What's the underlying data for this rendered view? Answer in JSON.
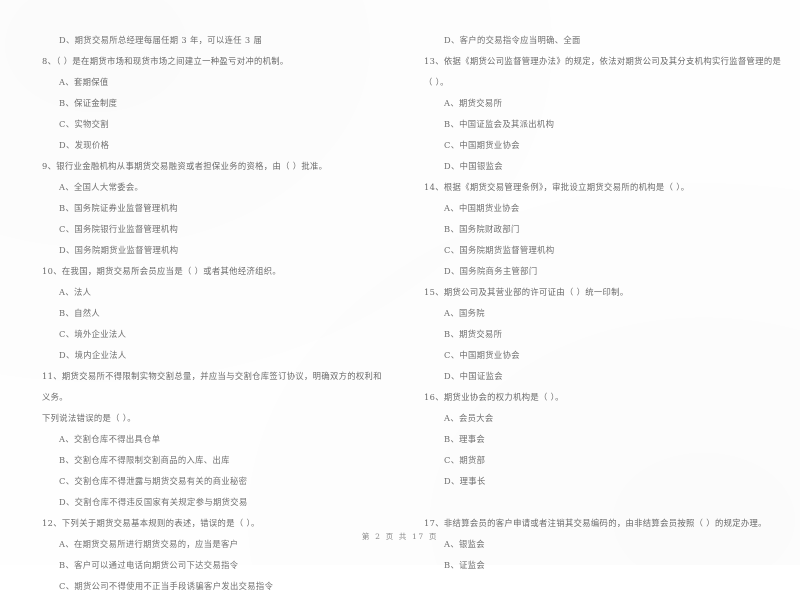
{
  "document": {
    "type": "exam-paper",
    "language": "zh-CN",
    "footer": "第 2 页 共 17 页"
  },
  "left_column": {
    "blocks": [
      {
        "kind": "option",
        "text": "D、期货交易所总经理每届任期 3 年，可以连任 3 届"
      },
      {
        "kind": "stem",
        "text": "8、（      ）是在期货市场和现货市场之间建立一种盈亏对冲的机制。"
      },
      {
        "kind": "option",
        "text": "A、套期保值"
      },
      {
        "kind": "option",
        "text": "B、保证金制度"
      },
      {
        "kind": "option",
        "text": "C、实物交割"
      },
      {
        "kind": "option",
        "text": "D、发现价格"
      },
      {
        "kind": "stem",
        "text": "9、银行业金融机构从事期货交易融资或者担保业务的资格，由（      ）批准。"
      },
      {
        "kind": "option",
        "text": "A、全国人大常委会。"
      },
      {
        "kind": "option",
        "text": "B、国务院证券业监督管理机构"
      },
      {
        "kind": "option",
        "text": "C、国务院银行业监督管理机构"
      },
      {
        "kind": "option",
        "text": "D、国务院期货业监督管理机构"
      },
      {
        "kind": "stem",
        "text": "10、在我国，期货交易所会员应当是（      ）或者其他经济组织。"
      },
      {
        "kind": "option",
        "text": "A、法人"
      },
      {
        "kind": "option",
        "text": "B、自然人"
      },
      {
        "kind": "option",
        "text": "C、境外企业法人"
      },
      {
        "kind": "option",
        "text": "D、境内企业法人"
      },
      {
        "kind": "stem",
        "text": "11、期货交易所不得限制实物交割总量，并应当与交割仓库签订协议，明确双方的权利和义务。"
      },
      {
        "kind": "stem",
        "text": "下列说法错误的是（      ）。"
      },
      {
        "kind": "option",
        "text": "A、交割仓库不得出具仓单"
      },
      {
        "kind": "option",
        "text": "B、交割仓库不得限制交割商品的入库、出库"
      },
      {
        "kind": "option",
        "text": "C、交割仓库不得泄露与期货交易有关的商业秘密"
      },
      {
        "kind": "option",
        "text": "D、交割仓库不得违反国家有关规定参与期货交易"
      },
      {
        "kind": "stem",
        "text": "12、下列关于期货交易基本规则的表述，错误的是（      ）。"
      },
      {
        "kind": "option",
        "text": "A、在期货交易所进行期货交易的，应当是客户"
      },
      {
        "kind": "option",
        "text": "B、客户可以通过电话向期货公司下达交易指令"
      },
      {
        "kind": "option",
        "text": "C、期货公司不得使用不正当手段诱骗客户发出交易指令"
      }
    ]
  },
  "right_column": {
    "blocks": [
      {
        "kind": "option",
        "text": "D、客户的交易指令应当明确、全面"
      },
      {
        "kind": "stem",
        "text": "13、依据《期货公司监督管理办法》的规定，依法对期货公司及其分支机构实行监督管理的是"
      },
      {
        "kind": "stem",
        "text": "（      ）。"
      },
      {
        "kind": "option",
        "text": "A、期货交易所"
      },
      {
        "kind": "option",
        "text": "B、中国证监会及其派出机构"
      },
      {
        "kind": "option",
        "text": "C、中国期货业协会"
      },
      {
        "kind": "option",
        "text": "D、中国银监会"
      },
      {
        "kind": "stem",
        "text": "14、根据《期货交易管理条例》，审批设立期货交易所的机构是（      ）。"
      },
      {
        "kind": "option",
        "text": "A、中国期货业协会"
      },
      {
        "kind": "option",
        "text": "B、国务院财政部门"
      },
      {
        "kind": "option",
        "text": "C、国务院期货监督管理机构"
      },
      {
        "kind": "option",
        "text": "D、国务院商务主管部门"
      },
      {
        "kind": "stem",
        "text": "15、期货公司及其营业部的许可证由（      ）统一印制。"
      },
      {
        "kind": "option",
        "text": "A、国务院"
      },
      {
        "kind": "option",
        "text": "B、期货交易所"
      },
      {
        "kind": "option",
        "text": "C、中国期货业协会"
      },
      {
        "kind": "option",
        "text": "D、中国证监会"
      },
      {
        "kind": "stem",
        "text": "16、期货业协会的权力机构是（      ）。"
      },
      {
        "kind": "option",
        "text": "A、会员大会"
      },
      {
        "kind": "option",
        "text": "B、理事会"
      },
      {
        "kind": "option",
        "text": "C、期货部"
      },
      {
        "kind": "option",
        "text": "D、理事长"
      },
      {
        "kind": "gap",
        "text": ""
      },
      {
        "kind": "stem",
        "text": "17、非结算会员的客户申请或者注销其交易编码的，由非结算会员按照（      ）的规定办理。"
      },
      {
        "kind": "option",
        "text": "A、银监会"
      },
      {
        "kind": "option",
        "text": "B、证监会"
      }
    ]
  }
}
